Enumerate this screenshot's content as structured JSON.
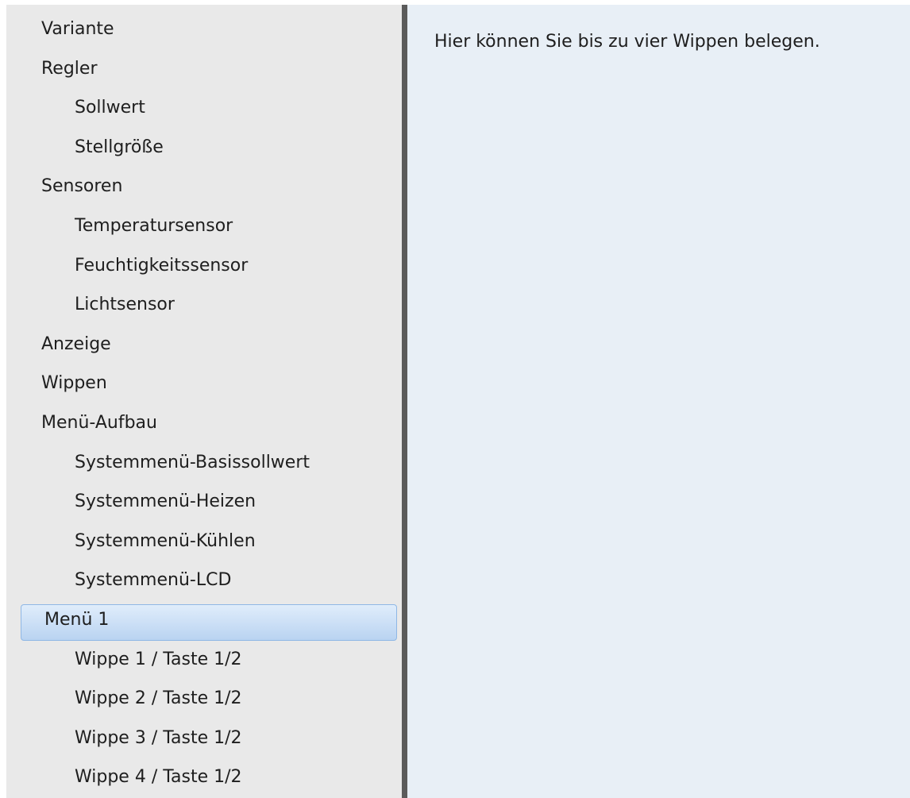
{
  "sidebar": {
    "items": [
      {
        "label": "Variante",
        "level": 0
      },
      {
        "label": "Regler",
        "level": 0
      },
      {
        "label": "Sollwert",
        "level": 1
      },
      {
        "label": "Stellgröße",
        "level": 1
      },
      {
        "label": "Sensoren",
        "level": 0
      },
      {
        "label": "Temperatursensor",
        "level": 1
      },
      {
        "label": "Feuchtigkeitssensor",
        "level": 1
      },
      {
        "label": "Lichtsensor",
        "level": 1
      },
      {
        "label": "Anzeige",
        "level": 0
      },
      {
        "label": "Wippen",
        "level": 0
      },
      {
        "label": "Menü-Aufbau",
        "level": 0
      },
      {
        "label": "Systemmenü-Basissollwert",
        "level": 1
      },
      {
        "label": "Systemmenü-Heizen",
        "level": 1
      },
      {
        "label": "Systemmenü-Kühlen",
        "level": 1
      },
      {
        "label": "Systemmenü-LCD",
        "level": 1
      },
      {
        "label": "Menü 1",
        "level": 0,
        "selected": true
      },
      {
        "label": "Wippe 1 / Taste 1/2",
        "level": 1
      },
      {
        "label": "Wippe 2 / Taste 1/2",
        "level": 1
      },
      {
        "label": "Wippe 3 / Taste 1/2",
        "level": 1
      },
      {
        "label": "Wippe 4 / Taste 1/2",
        "level": 1
      }
    ]
  },
  "content": {
    "description": "Hier können Sie bis zu vier Wippen belegen."
  },
  "colors": {
    "sidebar_background": "#e9e9e9",
    "content_background": "#e8eff6",
    "selection": "#b9d3f1"
  }
}
